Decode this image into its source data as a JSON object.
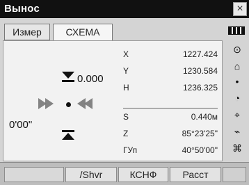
{
  "window": {
    "title": "Вынос",
    "close_glyph": "×"
  },
  "tabs": [
    {
      "label": "Измер"
    },
    {
      "label": "СХЕМА"
    }
  ],
  "guidance": {
    "vertical_offset": "0.000",
    "horizontal_angle": "0'00\""
  },
  "readouts": {
    "x": {
      "label": "X",
      "value": "1227.424"
    },
    "y": {
      "label": "Y",
      "value": "1230.584"
    },
    "h": {
      "label": "H",
      "value": "1236.325"
    },
    "s": {
      "label": "S",
      "value": "0.440м"
    },
    "z": {
      "label": "Z",
      "value": "85°23'25\""
    },
    "gyn": {
      "label": "ГУп",
      "value": "40°50'00\""
    }
  },
  "side_icons": [
    {
      "name": "battery-icon"
    },
    {
      "name": "target-icon"
    },
    {
      "name": "prism-icon"
    },
    {
      "name": "dot-icon"
    },
    {
      "name": "level-icon"
    },
    {
      "name": "measure-mode-icon"
    },
    {
      "name": "edm-icon"
    },
    {
      "name": "keyboard-icon"
    }
  ],
  "softkeys": [
    {
      "label": ""
    },
    {
      "label": "/Shvr"
    },
    {
      "label": "КСНФ"
    },
    {
      "label": "Расст"
    },
    {
      "label": ""
    }
  ]
}
